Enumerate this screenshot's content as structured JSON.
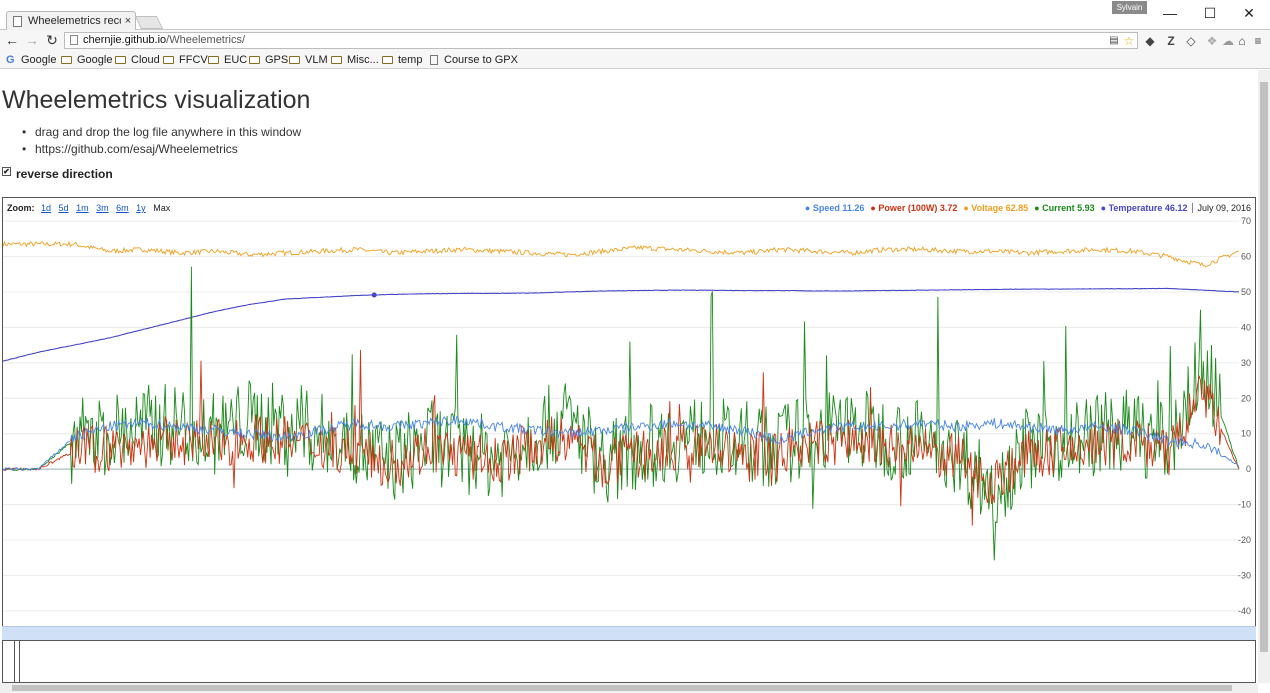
{
  "window": {
    "tab_title": "Wheelemetrics recor",
    "tab_close": "×",
    "profile_label": "Sylvain",
    "minimize": "—",
    "maximize": "☐",
    "close": "✕"
  },
  "toolbar": {
    "back": "←",
    "forward": "→",
    "reload": "↻",
    "url_host": "chernjie.github.io",
    "url_path": "/Wheelemetrics/",
    "star": "☆",
    "menu": "≡"
  },
  "bookmarks": [
    {
      "label": "Google",
      "icon": "google-icon"
    },
    {
      "label": "Google",
      "icon": "folder-icon"
    },
    {
      "label": "Cloud",
      "icon": "folder-icon"
    },
    {
      "label": "FFCV",
      "icon": "folder-icon"
    },
    {
      "label": "EUC",
      "icon": "folder-icon"
    },
    {
      "label": "GPS",
      "icon": "folder-icon"
    },
    {
      "label": "VLM",
      "icon": "folder-icon"
    },
    {
      "label": "Misc...",
      "icon": "folder-icon"
    },
    {
      "label": "temp",
      "icon": "folder-icon"
    },
    {
      "label": "Course to GPX",
      "icon": "page-icon"
    }
  ],
  "page": {
    "title": "Wheelemetrics visualization",
    "bullets": [
      "drag and drop the log file anywhere in this window",
      "https://github.com/esaj/Wheelemetrics"
    ],
    "reverse_label": "reverse direction",
    "reverse_checked": true
  },
  "chart_data": {
    "type": "line",
    "zoom_label": "Zoom:",
    "zoom_options": [
      "1d",
      "5d",
      "1m",
      "3m",
      "6m",
      "1y",
      "Max"
    ],
    "zoom_selected": "Max",
    "date": "July 09, 2016",
    "legend": [
      {
        "name": "Speed",
        "value": "11.26",
        "color": "#4a86e8"
      },
      {
        "name": "Power (100W)",
        "value": "3.72",
        "color": "#cc3311"
      },
      {
        "name": "Voltage",
        "value": "62.85",
        "color": "#f0a020"
      },
      {
        "name": "Current",
        "value": "5.93",
        "color": "#1a8a1a"
      },
      {
        "name": "Temperature",
        "value": "46.12",
        "color": "#4646c8"
      }
    ],
    "y_ticks": [
      70,
      60,
      50,
      40,
      30,
      20,
      10,
      0,
      -10,
      -20,
      -30,
      -40
    ],
    "ylim": [
      -42,
      72
    ],
    "series": [
      {
        "name": "Voltage",
        "color": "#f0a020",
        "values": [
          63.5,
          63.5,
          63.5,
          61.5,
          62.0,
          61.0,
          61.5,
          60.5,
          61.0,
          61.5,
          62.0,
          61.0,
          61.5,
          62.0,
          61.5,
          61.0,
          60.5,
          61.5,
          62.5,
          62.0,
          61.5,
          61.0,
          62.0,
          61.5,
          61.0,
          62.0,
          62.0,
          61.5,
          61.5,
          61.0,
          61.5,
          62.0,
          61.5,
          60.0,
          57.5,
          61.5
        ]
      },
      {
        "name": "Temperature",
        "color": "#4646c8",
        "values": [
          30.5,
          33.0,
          35.0,
          37.0,
          39.5,
          42.0,
          44.5,
          46.5,
          48.0,
          48.5,
          49.0,
          49.3,
          49.5,
          49.6,
          49.6,
          49.7,
          50.0,
          50.3,
          50.4,
          50.5,
          50.5,
          50.4,
          50.4,
          50.3,
          50.3,
          50.4,
          50.5,
          50.6,
          50.7,
          50.8,
          50.8,
          50.9,
          50.9,
          51.0,
          50.5,
          50.0
        ]
      },
      {
        "name": "Speed",
        "color": "#4a86e8",
        "values": [
          0,
          0,
          9,
          12,
          13,
          12,
          11,
          10,
          9,
          11,
          13,
          12,
          13,
          14,
          12,
          11,
          10,
          11,
          12,
          13,
          12,
          11,
          8,
          11,
          12,
          12,
          13,
          12,
          13,
          12,
          11,
          12,
          11,
          8,
          7,
          1
        ]
      },
      {
        "name": "Current",
        "color": "#1a8a1a",
        "values": [
          0,
          0,
          8,
          10,
          12,
          13,
          10,
          14,
          12,
          10,
          6,
          2,
          8,
          5,
          3,
          10,
          14,
          2,
          6,
          8,
          10,
          5,
          7,
          10,
          12,
          9,
          8,
          5,
          -6,
          6,
          8,
          10,
          11,
          6,
          30,
          0
        ]
      },
      {
        "name": "Power (100W)",
        "color": "#cc3311",
        "values": [
          0,
          0,
          5,
          6,
          7,
          8,
          7,
          9,
          8,
          7,
          5,
          1,
          6,
          4,
          2,
          7,
          9,
          1,
          4,
          5,
          7,
          3,
          5,
          7,
          8,
          6,
          5,
          3,
          -4,
          4,
          5,
          7,
          8,
          4,
          22,
          0
        ]
      }
    ]
  }
}
